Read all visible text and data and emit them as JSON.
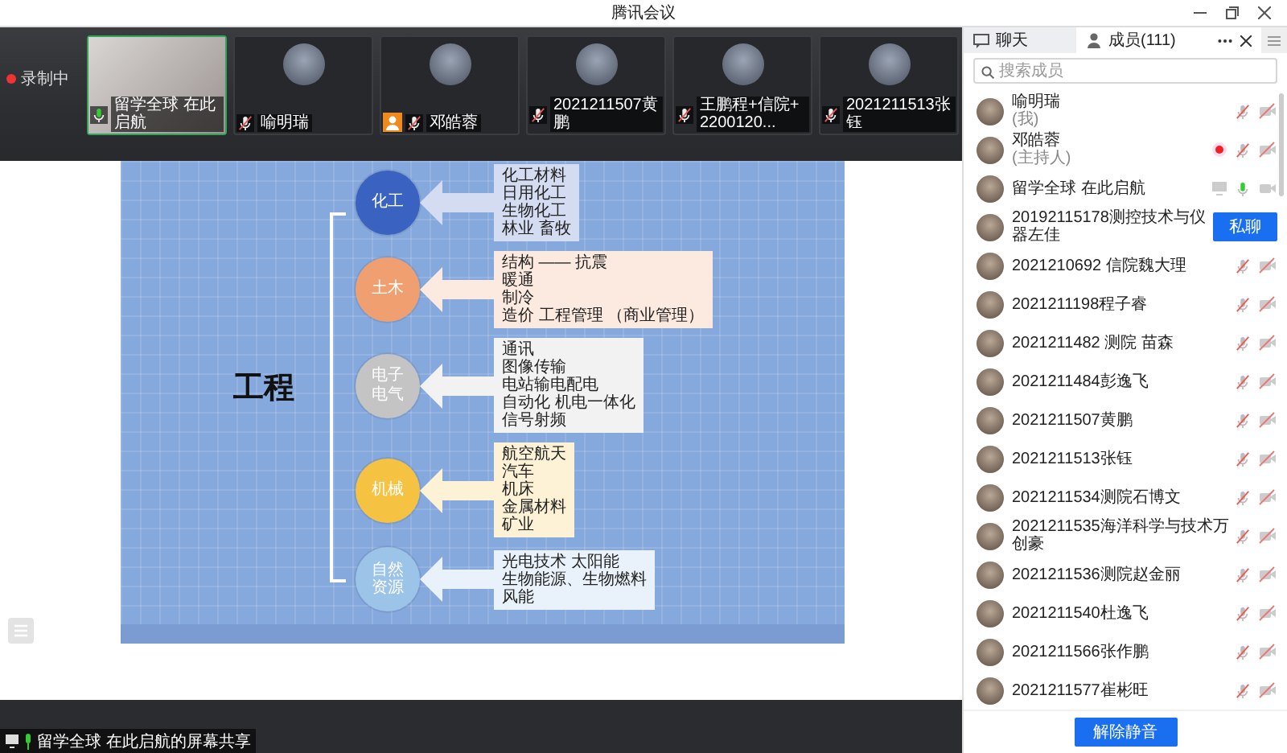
{
  "window": {
    "title": "腾讯会议"
  },
  "recording": {
    "label": "录制中",
    "on": true
  },
  "video_tiles": [
    {
      "kind": "video",
      "name": "留学全球 在此启航",
      "selected": true,
      "mic_muted": false,
      "host": false
    },
    {
      "kind": "avatar",
      "name": "喻明瑞",
      "selected": false,
      "mic_muted": true,
      "host": false
    },
    {
      "kind": "avatar",
      "name": "邓皓蓉",
      "selected": false,
      "mic_muted": true,
      "host": true
    },
    {
      "kind": "avatar",
      "name": "2021211507黄鹏",
      "selected": false,
      "mic_muted": true,
      "host": false
    },
    {
      "kind": "avatar",
      "name": "王鹏程+信院+2200120...",
      "selected": false,
      "mic_muted": true,
      "host": false
    },
    {
      "kind": "avatar",
      "name": "2021211513张钰",
      "selected": false,
      "mic_muted": true,
      "host": false
    }
  ],
  "slide": {
    "title": "工程",
    "branches": [
      {
        "label": "化工",
        "color": "#3a62c0",
        "items": [
          "化工材料",
          "日用化工",
          "生物化工",
          "林业  畜牧"
        ]
      },
      {
        "label": "土木",
        "color": "#f0a070",
        "items": [
          "结构 —— 抗震",
          "暖通",
          "制冷",
          "造价  工程管理 （商业管理）"
        ]
      },
      {
        "label": "电子电气",
        "color": "#c4c4c4",
        "items": [
          "通讯",
          "图像传输",
          "电站输电配电",
          "自动化 机电一体化",
          "信号射频"
        ]
      },
      {
        "label": "机械",
        "color": "#f5c242",
        "items": [
          "航空航天",
          "汽车",
          "机床",
          "金属材料",
          "矿业"
        ]
      },
      {
        "label": "自然资源",
        "color": "#9cc3e8",
        "items": [
          "光电技术  太阳能",
          "生物能源、生物燃料",
          "风能"
        ]
      }
    ]
  },
  "share_bar": {
    "label": "留学全球 在此启航的屏幕共享"
  },
  "panel": {
    "tabs": [
      {
        "label": "聊天",
        "selected": false
      },
      {
        "label": "成员(111)",
        "selected": true
      }
    ],
    "search": {
      "placeholder": "搜索成员"
    },
    "members": [
      {
        "kind": "normal",
        "name": "喻明瑞",
        "role": "(我)",
        "mic_muted": true,
        "camera_muted": true,
        "recording": false,
        "sharing": false
      },
      {
        "kind": "normal",
        "name": "邓皓蓉",
        "role": "(主持人)",
        "mic_muted": true,
        "camera_muted": true,
        "recording": true,
        "sharing": false
      },
      {
        "kind": "normal",
        "name": "留学全球 在此启航",
        "mic_muted": false,
        "camera_muted": false,
        "recording": false,
        "sharing": true
      },
      {
        "kind": "hover",
        "name": "20192115178测控技术与仪器左佳",
        "action": "私聊"
      },
      {
        "kind": "normal",
        "name": "2021210692 信院魏大理",
        "mic_muted": true,
        "camera_muted": true,
        "recording": false,
        "sharing": false
      },
      {
        "kind": "normal",
        "name": "2021211198程子睿",
        "mic_muted": true,
        "camera_muted": true,
        "recording": false,
        "sharing": false
      },
      {
        "kind": "normal",
        "name": "2021211482 测院 苗森",
        "mic_muted": true,
        "camera_muted": true,
        "recording": false,
        "sharing": false
      },
      {
        "kind": "normal",
        "name": "2021211484彭逸飞",
        "mic_muted": true,
        "camera_muted": true,
        "recording": false,
        "sharing": false
      },
      {
        "kind": "normal",
        "name": "2021211507黄鹏",
        "mic_muted": true,
        "camera_muted": true,
        "recording": false,
        "sharing": false
      },
      {
        "kind": "normal",
        "name": "2021211513张钰",
        "mic_muted": true,
        "camera_muted": true,
        "recording": false,
        "sharing": false
      },
      {
        "kind": "normal",
        "name": "2021211534测院石博文",
        "mic_muted": true,
        "camera_muted": true,
        "recording": false,
        "sharing": false
      },
      {
        "kind": "normal",
        "name": "2021211535海洋科学与技术万创豪",
        "mic_muted": true,
        "camera_muted": true,
        "recording": false,
        "sharing": false
      },
      {
        "kind": "normal",
        "name": "2021211536测院赵金丽",
        "mic_muted": true,
        "camera_muted": true,
        "recording": false,
        "sharing": false
      },
      {
        "kind": "normal",
        "name": "2021211540杜逸飞",
        "mic_muted": true,
        "camera_muted": true,
        "recording": false,
        "sharing": false
      },
      {
        "kind": "normal",
        "name": "2021211566张作鹏",
        "mic_muted": true,
        "camera_muted": true,
        "recording": false,
        "sharing": false
      },
      {
        "kind": "normal",
        "name": "2021211577崔彬旺",
        "mic_muted": true,
        "camera_muted": true,
        "recording": false,
        "sharing": false
      }
    ],
    "footer_button": "解除静音"
  }
}
